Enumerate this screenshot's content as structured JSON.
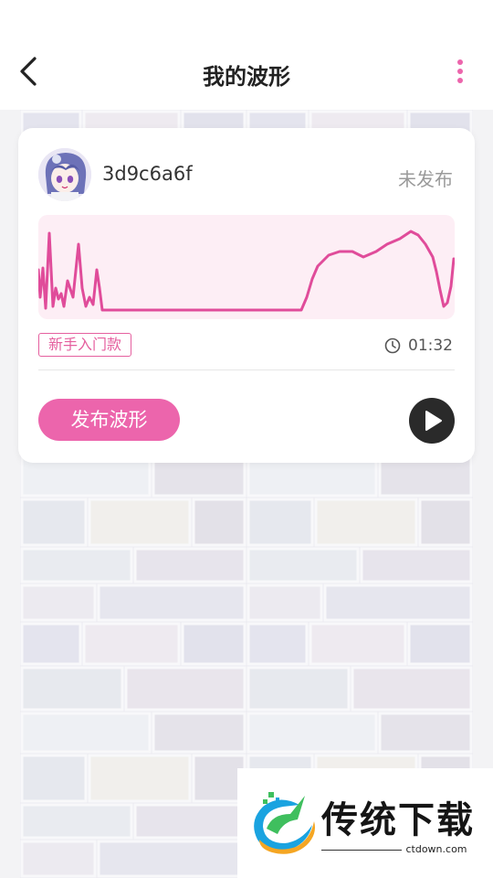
{
  "header": {
    "title": "我的波形"
  },
  "card": {
    "username": "3d9c6a6f",
    "status": "未发布",
    "tag": "新手入门款",
    "duration": "01:32",
    "publish_label": "发布波形"
  },
  "watermark": {
    "brand": "传统下载",
    "url": "ctdown.com"
  },
  "colors": {
    "accent": "#ec65ac",
    "wave_line": "#e04c9a",
    "wave_bg": "#fdeef5"
  },
  "icons": {
    "back": "chevron-left-icon",
    "more": "more-vertical-icon",
    "clock": "clock-icon",
    "play": "play-icon"
  }
}
